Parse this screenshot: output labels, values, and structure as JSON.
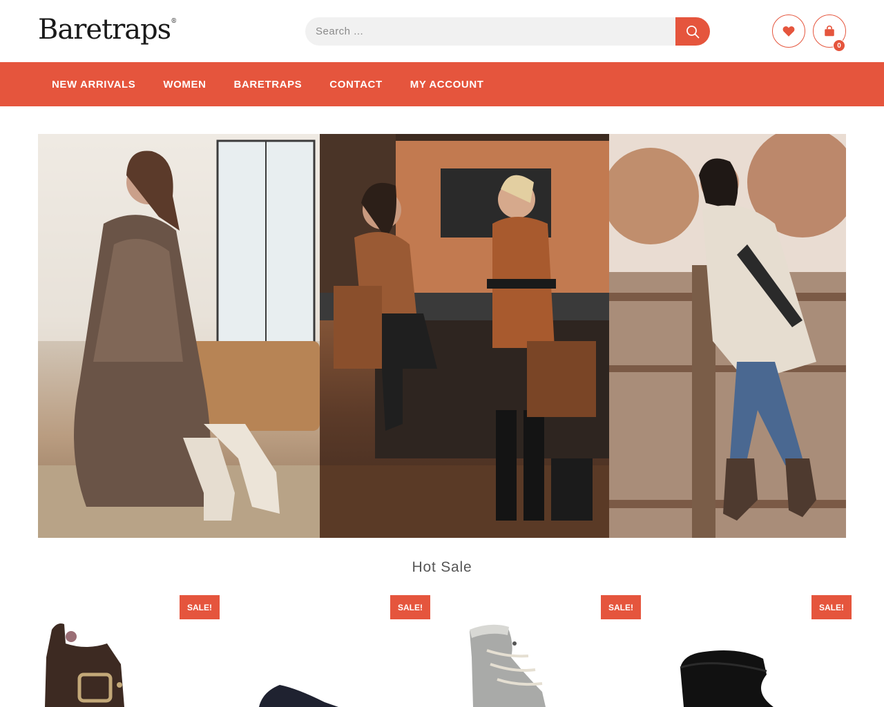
{
  "header": {
    "logo_text": "Baretraps",
    "logo_mark": "®",
    "search_placeholder": "Search ...",
    "cart_count": "0",
    "icons": {
      "search": "search-icon",
      "wishlist": "heart-icon",
      "cart": "shopping-bag-icon"
    }
  },
  "nav": {
    "items": [
      {
        "label": "NEW ARRIVALS"
      },
      {
        "label": "WOMEN"
      },
      {
        "label": "BARETRAPS"
      },
      {
        "label": "CONTACT"
      },
      {
        "label": "MY ACCOUNT"
      }
    ]
  },
  "hot_sale": {
    "title": "Hot Sale",
    "products": [
      {
        "badge": "SALE!"
      },
      {
        "badge": "SALE!"
      },
      {
        "badge": "SALE!"
      },
      {
        "badge": "SALE!"
      }
    ]
  },
  "colors": {
    "accent": "#e5553d"
  }
}
